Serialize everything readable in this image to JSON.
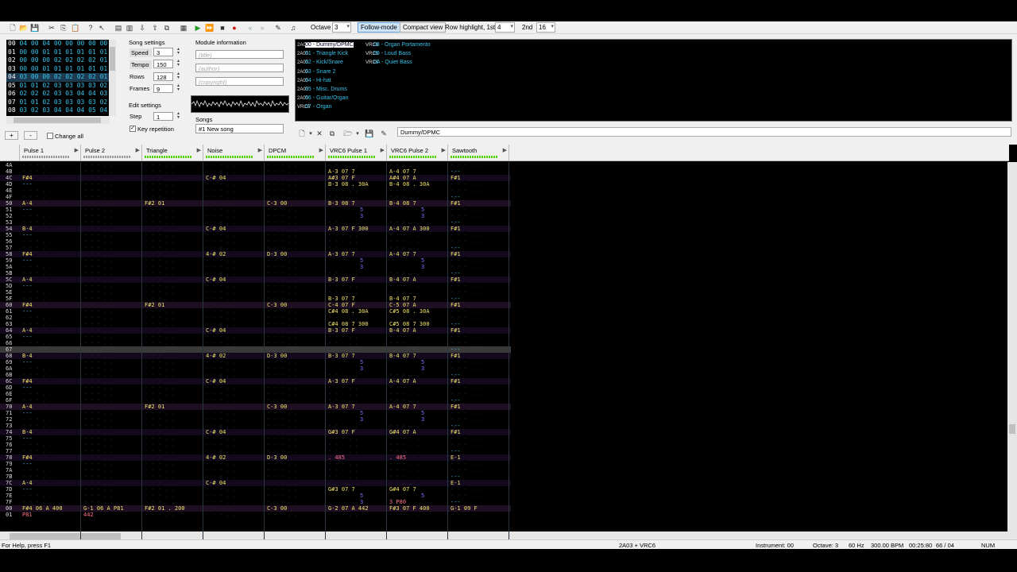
{
  "toolbar": {
    "octave_label": "Octave",
    "octave_value": "3",
    "follow_mode": "Follow-mode",
    "compact_view": "Compact view",
    "row_hl_1st_label": "Row highlight, 1st",
    "row_hl_1st": "4",
    "row_hl_2nd_label": "2nd",
    "row_hl_2nd": "16"
  },
  "frames": {
    "rows": [
      {
        "n": "00",
        "v": "04 00 04 00 00 00 00 00"
      },
      {
        "n": "01",
        "v": "00 00 01 01 01 01 01 01"
      },
      {
        "n": "02",
        "v": "00 00 00 02 02 02 02 01"
      },
      {
        "n": "03",
        "v": "00 00 01 01 01 01 01 01"
      },
      {
        "n": "04",
        "v": "03 00 00 02 02 02 02 01"
      },
      {
        "n": "05",
        "v": "01 01 02 03 03 03 03 02"
      },
      {
        "n": "06",
        "v": "02 02 02 03 03 04 04 03"
      },
      {
        "n": "07",
        "v": "01 01 02 03 03 03 03 02"
      },
      {
        "n": "08",
        "v": "03 02 03 04 04 04 05 04"
      }
    ],
    "add_label": "+",
    "remove_label": "-",
    "change_all": "Change all"
  },
  "song_settings": {
    "title": "Song settings",
    "speed_label": "Speed",
    "speed": "3",
    "tempo_label": "Tempo",
    "tempo": "150",
    "rows_label": "Rows",
    "rows": "128",
    "frames_label": "Frames",
    "frames": "9"
  },
  "edit_settings": {
    "title": "Edit settings",
    "step_label": "Step",
    "step": "1",
    "key_repetition": "Key repetition"
  },
  "module_info": {
    "title": "Module information",
    "title_ph": "(title)",
    "author_ph": "(author)",
    "copyright_ph": "(copyright)",
    "songs_label": "Songs",
    "song_selected": "#1 New song"
  },
  "instruments": [
    {
      "id": "00",
      "name": "00 - Dummy/DPMC",
      "type": "2A03",
      "selected": true
    },
    {
      "id": "01",
      "name": "01 - Triangle Kick",
      "type": "2A03"
    },
    {
      "id": "02",
      "name": "02 - Kick/Snare",
      "type": "2A03"
    },
    {
      "id": "03",
      "name": "03 - Snare 2",
      "type": "2A03"
    },
    {
      "id": "04",
      "name": "04 - Hi-hat",
      "type": "2A03"
    },
    {
      "id": "05",
      "name": "05 - Misc. Drums",
      "type": "2A03"
    },
    {
      "id": "06",
      "name": "06 - Guitar/Organ",
      "type": "2A03"
    },
    {
      "id": "07",
      "name": "07 - Organ",
      "type": "VRC6"
    },
    {
      "id": "08",
      "name": "08 - Organ Portamento",
      "type": "VRC6"
    },
    {
      "id": "09",
      "name": "09 - Loud Bass",
      "type": "VRC6"
    },
    {
      "id": "0A",
      "name": "0A - Quiet Bass",
      "type": "VRC6"
    }
  ],
  "instrument_name": "Dummy/DPMC",
  "channels": [
    "Pulse 1",
    "Pulse 2",
    "Triangle",
    "Noise",
    "DPCM",
    "VRC6 Pulse 1",
    "VRC6 Pulse 2",
    "Sawtooth"
  ],
  "pattern_rows": [
    {
      "r": "4A",
      "c": [
        "",
        "",
        "",
        "",
        "",
        "",
        "",
        ""
      ]
    },
    {
      "r": "4B",
      "c": [
        "",
        "",
        "",
        "",
        "",
        "A-3 07 7",
        "A-4 07 7",
        "---"
      ]
    },
    {
      "r": "4C",
      "c": [
        "F#4",
        "",
        "",
        "C-# 04",
        "",
        "A#3 07 F",
        "A#4 07 A",
        "F#1"
      ]
    },
    {
      "r": "4D",
      "c": [
        "---",
        "",
        "",
        "",
        "",
        "B-3 08 . 30A",
        "B-4 08 . 30A",
        ""
      ]
    },
    {
      "r": "4E",
      "c": [
        "",
        "",
        "",
        "",
        "",
        "",
        "",
        ""
      ]
    },
    {
      "r": "4F",
      "c": [
        "",
        "",
        "",
        "",
        "",
        "",
        "",
        "---"
      ]
    },
    {
      "r": "50",
      "c": [
        "A-4",
        "",
        "F#2 01",
        "",
        "C-3 00",
        "B-3 08 7",
        "B-4 08 7",
        "F#1"
      ]
    },
    {
      "r": "51",
      "c": [
        "---",
        "",
        "",
        "",
        "",
        "5",
        "5",
        ""
      ]
    },
    {
      "r": "52",
      "c": [
        "",
        "",
        "",
        "",
        "",
        "3",
        "3",
        ""
      ]
    },
    {
      "r": "53",
      "c": [
        "",
        "",
        "",
        "",
        "",
        "",
        "",
        "---"
      ]
    },
    {
      "r": "54",
      "c": [
        "B-4",
        "",
        "",
        "C-# 04",
        "",
        "A-3 07 F 300",
        "A-4 07 A 300",
        "F#1"
      ]
    },
    {
      "r": "55",
      "c": [
        "---",
        "",
        "",
        "",
        "",
        "",
        "",
        ""
      ]
    },
    {
      "r": "56",
      "c": [
        "",
        "",
        "",
        "",
        "",
        "",
        "",
        ""
      ]
    },
    {
      "r": "57",
      "c": [
        "",
        "",
        "",
        "",
        "",
        "",
        "",
        "---"
      ]
    },
    {
      "r": "58",
      "c": [
        "F#4",
        "",
        "",
        "4-# 02",
        "D-3 00",
        "A-3 07 7",
        "A-4 07 7",
        "F#1"
      ]
    },
    {
      "r": "59",
      "c": [
        "---",
        "",
        "",
        "",
        "",
        "5",
        "5",
        ""
      ]
    },
    {
      "r": "5A",
      "c": [
        "",
        "",
        "",
        "",
        "",
        "3",
        "3",
        ""
      ]
    },
    {
      "r": "5B",
      "c": [
        "",
        "",
        "",
        "",
        "",
        "",
        "",
        "---"
      ]
    },
    {
      "r": "5C",
      "c": [
        "A-4",
        "",
        "",
        "C-# 04",
        "",
        "B-3 07 F",
        "B-4 07 A",
        "F#1"
      ]
    },
    {
      "r": "5D",
      "c": [
        "---",
        "",
        "",
        "",
        "",
        "",
        "",
        ""
      ]
    },
    {
      "r": "5E",
      "c": [
        "",
        "",
        "",
        "",
        "",
        "",
        "",
        ""
      ]
    },
    {
      "r": "5F",
      "c": [
        "",
        "",
        "",
        "",
        "",
        "B-3 07 7",
        "B-4 07 7",
        "---"
      ]
    },
    {
      "r": "60",
      "c": [
        "F#4",
        "",
        "F#2 01",
        "",
        "C-3 00",
        "C-4 07 F",
        "C-5 07 A",
        "F#1"
      ]
    },
    {
      "r": "61",
      "c": [
        "---",
        "",
        "",
        "",
        "",
        "C#4 08 . 30A",
        "C#5 08 . 30A",
        ""
      ]
    },
    {
      "r": "62",
      "c": [
        "",
        "",
        "",
        "",
        "",
        "",
        "",
        ""
      ]
    },
    {
      "r": "63",
      "c": [
        "",
        "",
        "",
        "",
        "",
        "C#4 08 7 300",
        "C#5 08 7 300",
        "---"
      ]
    },
    {
      "r": "64",
      "c": [
        "A-4",
        "",
        "",
        "C-# 04",
        "",
        "B-3 07 F",
        "B-4 07 A",
        "F#1"
      ]
    },
    {
      "r": "65",
      "c": [
        "---",
        "",
        "",
        "",
        "",
        "",
        "",
        ""
      ]
    },
    {
      "r": "66",
      "c": [
        "",
        "",
        "",
        "",
        "",
        "",
        "",
        ""
      ]
    },
    {
      "r": "67",
      "c": [
        "",
        "",
        "",
        "",
        "",
        "",
        "",
        "---"
      ]
    },
    {
      "r": "68",
      "c": [
        "B-4",
        "",
        "",
        "4-# 02",
        "D-3 00",
        "B-3 07 7",
        "B-4 07 7",
        "F#1"
      ]
    },
    {
      "r": "69",
      "c": [
        "---",
        "",
        "",
        "",
        "",
        "5",
        "5",
        ""
      ]
    },
    {
      "r": "6A",
      "c": [
        "",
        "",
        "",
        "",
        "",
        "3",
        "3",
        ""
      ]
    },
    {
      "r": "6B",
      "c": [
        "",
        "",
        "",
        "",
        "",
        "",
        "",
        "---"
      ]
    },
    {
      "r": "6C",
      "c": [
        "F#4",
        "",
        "",
        "C-# 04",
        "",
        "A-3 07 F",
        "A-4 07 A",
        "F#1"
      ]
    },
    {
      "r": "6D",
      "c": [
        "---",
        "",
        "",
        "",
        "",
        "",
        "",
        ""
      ]
    },
    {
      "r": "6E",
      "c": [
        "",
        "",
        "",
        "",
        "",
        "",
        "",
        ""
      ]
    },
    {
      "r": "6F",
      "c": [
        "",
        "",
        "",
        "",
        "",
        "",
        "",
        "---"
      ]
    },
    {
      "r": "70",
      "c": [
        "A-4",
        "",
        "F#2 01",
        "",
        "C-3 00",
        "A-3 07 7",
        "A-4 07 7",
        "F#1"
      ]
    },
    {
      "r": "71",
      "c": [
        "---",
        "",
        "",
        "",
        "",
        "5",
        "5",
        ""
      ]
    },
    {
      "r": "72",
      "c": [
        "",
        "",
        "",
        "",
        "",
        "3",
        "3",
        ""
      ]
    },
    {
      "r": "73",
      "c": [
        "",
        "",
        "",
        "",
        "",
        "",
        "",
        "---"
      ]
    },
    {
      "r": "74",
      "c": [
        "B-4",
        "",
        "",
        "C-# 04",
        "",
        "G#3 07 F",
        "G#4 07 A",
        "F#1"
      ]
    },
    {
      "r": "75",
      "c": [
        "---",
        "",
        "",
        "",
        "",
        "",
        "",
        ""
      ]
    },
    {
      "r": "76",
      "c": [
        "",
        "",
        "",
        "",
        "",
        "",
        "",
        ""
      ]
    },
    {
      "r": "77",
      "c": [
        "",
        "",
        "",
        "",
        "",
        "",
        "",
        "---"
      ]
    },
    {
      "r": "78",
      "c": [
        "F#4",
        "",
        "",
        "4-# 02",
        "D-3 00",
        ". 485",
        ". 485",
        "E-1"
      ]
    },
    {
      "r": "79",
      "c": [
        "---",
        "",
        "",
        "",
        "",
        "",
        "",
        ""
      ]
    },
    {
      "r": "7A",
      "c": [
        "",
        "",
        "",
        "",
        "",
        "",
        "",
        ""
      ]
    },
    {
      "r": "7B",
      "c": [
        "",
        "",
        "",
        "",
        "",
        "",
        "",
        "---"
      ]
    },
    {
      "r": "7C",
      "c": [
        "A-4",
        "",
        "",
        "C-# 04",
        "",
        "",
        "",
        "E-1"
      ]
    },
    {
      "r": "7D",
      "c": [
        "---",
        "",
        "",
        "",
        "",
        "G#3 07 7",
        "G#4 07 7",
        ""
      ]
    },
    {
      "r": "7E",
      "c": [
        "",
        "",
        "",
        "",
        "",
        "5",
        "5",
        ""
      ]
    },
    {
      "r": "7F",
      "c": [
        "",
        "",
        "",
        "",
        "",
        "3",
        "3 P80",
        "---"
      ]
    },
    {
      "r": "00",
      "c": [
        "F#4 06 A 400",
        "G-1 06 A P81",
        "F#2 01 . 200",
        "",
        "C-3 00",
        "G-2 07 A 442",
        "F#3 07 F 400",
        "G-1 09 F"
      ]
    },
    {
      "r": "01",
      "c": [
        "P81",
        "442",
        "",
        "",
        "",
        "",
        "",
        ""
      ]
    }
  ],
  "status": {
    "help": "For Help, press F1",
    "chip": "2A03 + VRC6",
    "instrument": "Instrument: 00",
    "octave": "Octave: 3",
    "rate": "60 Hz",
    "bpm": "300.00 BPM",
    "time": "00:25:80",
    "position": "66 / 04",
    "num": "NUM"
  }
}
